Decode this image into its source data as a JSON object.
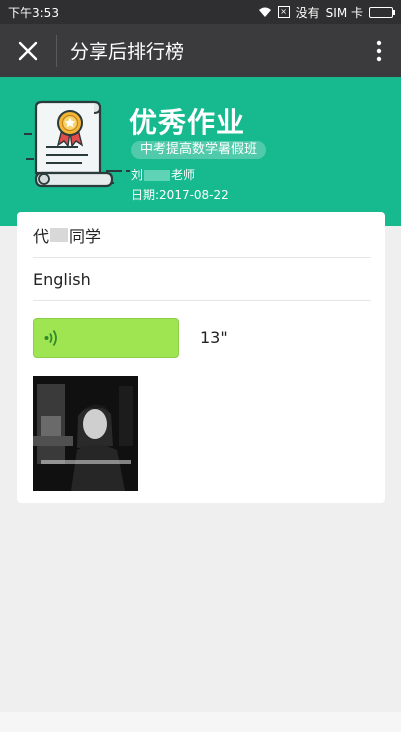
{
  "status_bar": {
    "time": "下午3:53",
    "no_service": "没有",
    "sim": "SIM 卡"
  },
  "title_bar": {
    "title": "分享后排行榜"
  },
  "header": {
    "heading": "优秀作业",
    "class_name": "中考提高数学暑假班",
    "teacher_prefix": "刘",
    "teacher_suffix": "老师",
    "date": "日期:2017-08-22"
  },
  "card": {
    "student_prefix": "代",
    "student_suffix": "同学",
    "subject": "English",
    "voice_duration": "13\""
  },
  "colors": {
    "brand_green": "#17b98f",
    "voice_green": "#9ee551",
    "title_bar": "#3b3b3d"
  },
  "icons": {
    "close": "close-icon",
    "more": "more-vertical-icon",
    "certificate": "certificate-icon",
    "voice": "voice-wave-icon",
    "wifi": "wifi-icon",
    "battery": "battery-icon"
  }
}
